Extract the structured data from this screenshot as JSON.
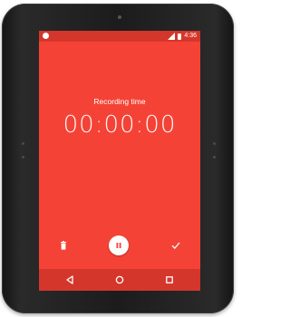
{
  "status_bar": {
    "time": "4:36",
    "icons": [
      "notification-dot-icon",
      "wifi-icon",
      "battery-icon"
    ]
  },
  "recorder": {
    "label": "Recording time",
    "elapsed": "00:00:00"
  },
  "actions": {
    "delete_icon": "trash-icon",
    "pause_icon": "pause-icon",
    "done_icon": "check-icon"
  },
  "navigation": {
    "back_icon": "back-triangle-icon",
    "home_icon": "home-circle-icon",
    "recents_icon": "recents-square-icon"
  },
  "colors": {
    "accent": "#f44336",
    "accent_dark": "#d5362b",
    "foreground": "#ffffff"
  }
}
